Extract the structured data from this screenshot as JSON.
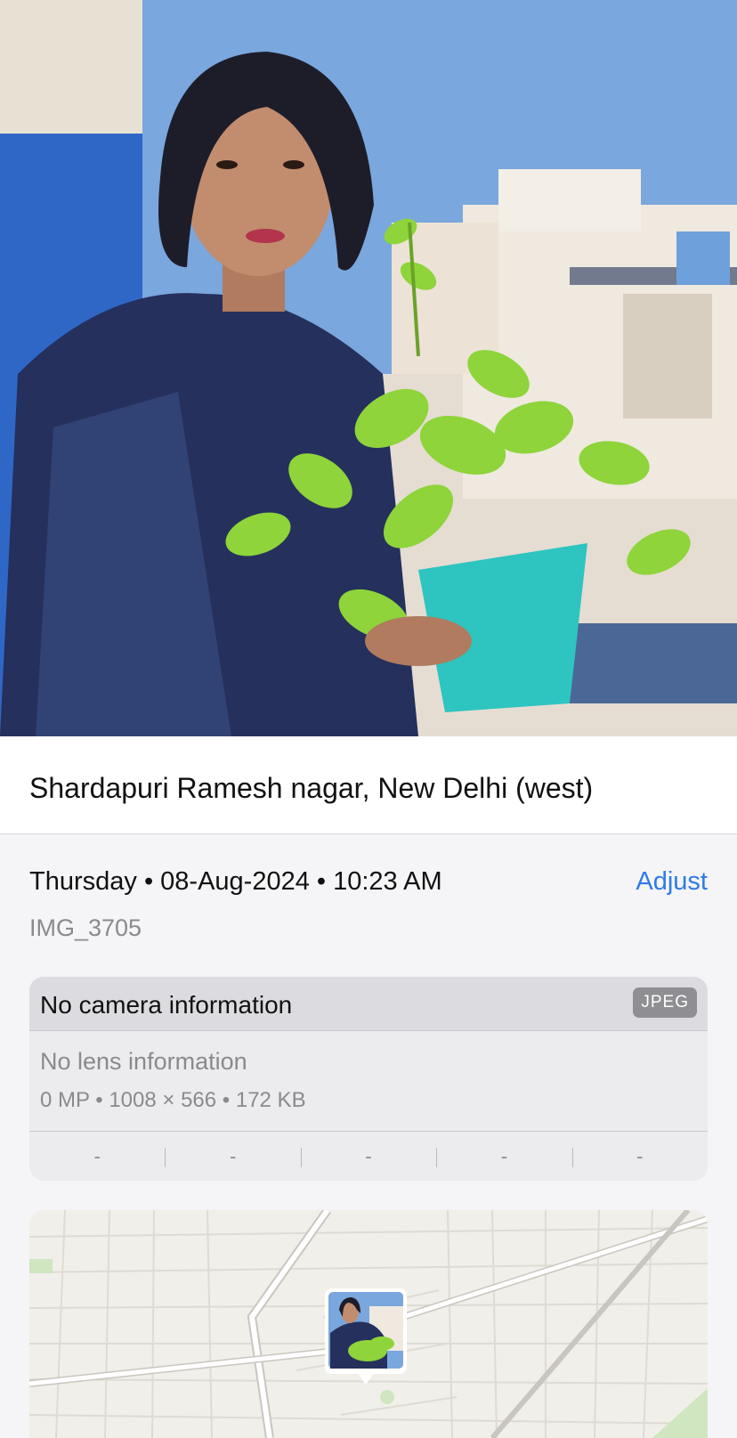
{
  "photo": {
    "icon": "photo-of-woman-holding-plant"
  },
  "caption": {
    "location": "Shardapuri Ramesh nagar, New Delhi (west)"
  },
  "meta": {
    "datetime": "Thursday • 08-Aug-2024 • 10:23 AM",
    "adjust_label": "Adjust",
    "filename": "IMG_3705"
  },
  "camera": {
    "label": "No camera information",
    "format_badge": "JPEG",
    "lens": "No lens information",
    "specs": "0 MP  •  1008 × 566  •  172 KB",
    "exif_values": [
      "-",
      "-",
      "-",
      "-",
      "-"
    ]
  },
  "map": {
    "icon": "map-icon",
    "pin_icon": "photo-thumbnail-pin"
  },
  "colors": {
    "accent": "#2f7be5",
    "background": "#f5f5f7",
    "card": "#ececef"
  }
}
